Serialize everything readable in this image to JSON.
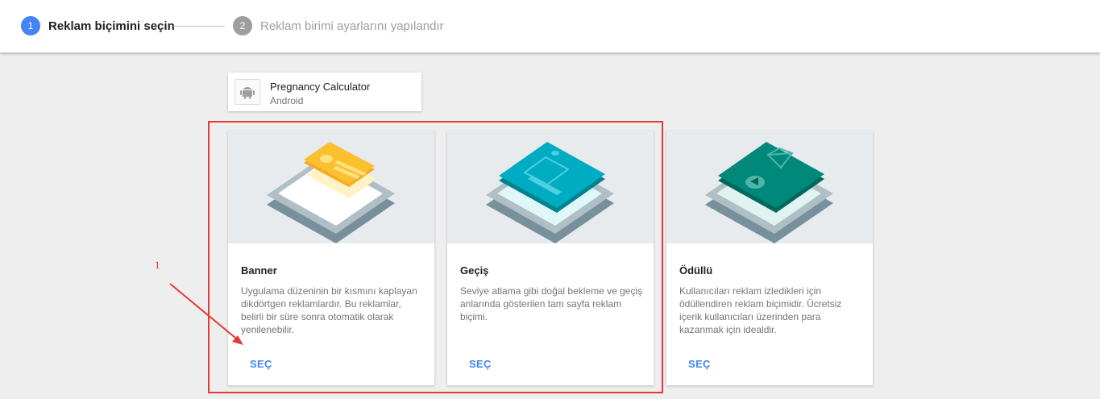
{
  "stepper": {
    "step1": {
      "number": "1",
      "label": "Reklam biçimini seçin"
    },
    "step2": {
      "number": "2",
      "label": "Reklam birimi ayarlarını yapılandır"
    }
  },
  "app": {
    "name": "Pregnancy Calculator",
    "platform": "Android",
    "icon": "android-icon"
  },
  "formats": [
    {
      "title": "Banner",
      "description": "Uygulama düzeninin bir kısmını kaplayan dikdörtgen reklamlardır. Bu reklamlar, belirli bir süre sonra otomatik olarak yenilenebilir.",
      "button": "SEÇ",
      "accent": "#fbc02d"
    },
    {
      "title": "Geçiş",
      "description": "Seviye atlama gibi doğal bekleme ve geçiş anlarında gösterilen tam sayfa reklam biçimi.",
      "button": "SEÇ",
      "accent": "#00acc1"
    },
    {
      "title": "Ödüllü",
      "description": "Kullanıcıları reklam izledikleri için ödüllendiren reklam biçimidir. Ücretsiz içerik kullanıcıları üzerinden para kazanmak için idealdir.",
      "button": "SEÇ",
      "accent": "#00897b"
    }
  ],
  "annotation": {
    "label": "1",
    "color": "#e53935"
  },
  "colors": {
    "primary": "#4285f4",
    "inactive": "#9e9e9e"
  }
}
